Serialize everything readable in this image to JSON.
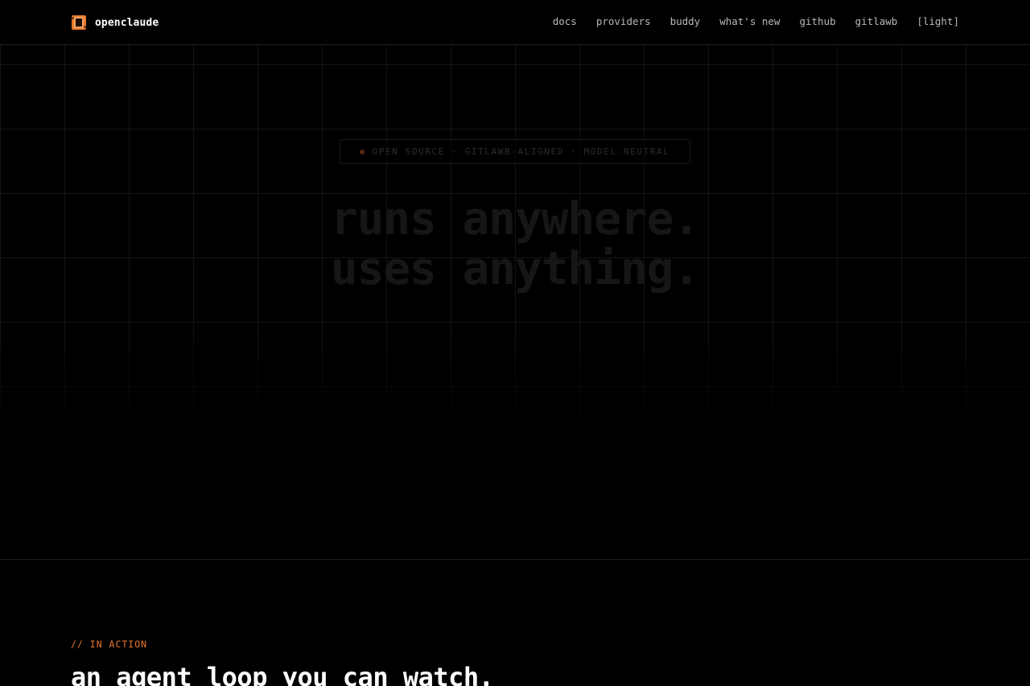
{
  "brand": {
    "name": "openclaude",
    "logo_icon": "openclaude-logo-icon",
    "accent_color": "#e8792f"
  },
  "nav": {
    "items": [
      {
        "label": "docs"
      },
      {
        "label": "providers"
      },
      {
        "label": "buddy"
      },
      {
        "label": "what's new"
      },
      {
        "label": "github"
      },
      {
        "label": "gitlawb"
      },
      {
        "label": "[light]"
      }
    ]
  },
  "hero": {
    "badge": "OPEN SOURCE · GITLAWB-ALIGNED · MODEL-NEUTRAL",
    "headline_line1": "runs anywhere.",
    "headline_line2": "uses anything."
  },
  "in_action": {
    "eyebrow": "// IN ACTION",
    "title": "an agent loop you can watch."
  }
}
